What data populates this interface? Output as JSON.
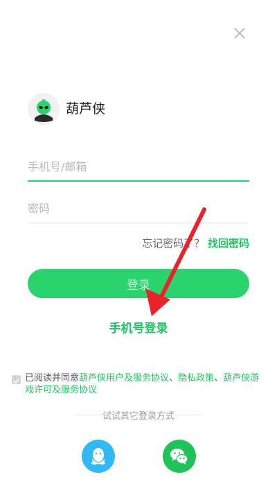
{
  "brand": {
    "name": "葫芦侠",
    "logo_icon": "alien-logo-icon"
  },
  "form": {
    "account_placeholder": "手机号/邮箱",
    "password_placeholder": "密码",
    "forgot_text": "忘记密码了？",
    "forgot_link": "找回密码",
    "login_button": "登录",
    "phone_login": "手机号登录"
  },
  "agreement": {
    "prefix": "已阅读并同意",
    "link1": "葫芦侠用户及服务协议",
    "sep1": "、",
    "link2": "隐私政策",
    "sep2": "、",
    "link3": "葫芦侠游戏许可及服务协议"
  },
  "other_login": {
    "title": "试试其它登录方式",
    "providers": [
      {
        "name": "qq",
        "icon": "qq-icon",
        "color": "#31b9f6"
      },
      {
        "name": "wechat",
        "icon": "wechat-icon",
        "color": "#20c35a"
      }
    ]
  },
  "colors": {
    "accent": "#2bd36e",
    "link": "#1fc764",
    "annotation_arrow": "#e8232b"
  }
}
